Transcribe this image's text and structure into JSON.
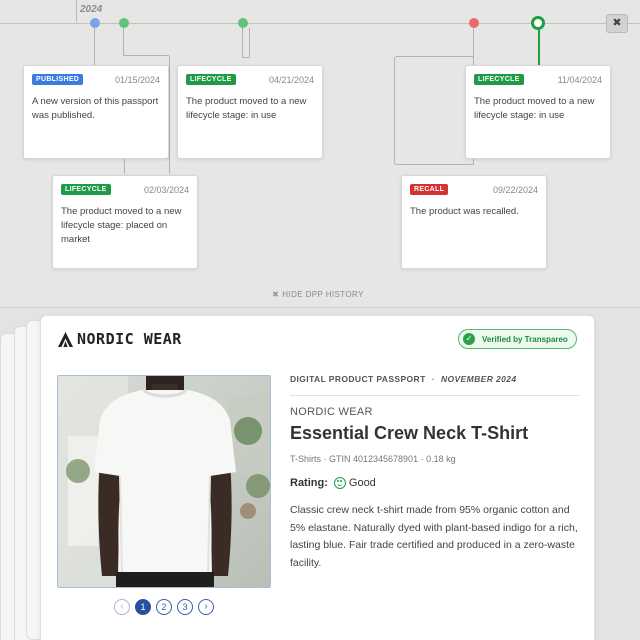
{
  "timeline": {
    "year": "2024",
    "close_label": "✖",
    "hide_label": "HIDE DPP HISTORY",
    "hide_icon": "✖",
    "events": [
      {
        "badge": "PUBLISHED",
        "date": "01/15/2024",
        "text": "A new version of this passport was published."
      },
      {
        "badge": "LIFECYCLE",
        "date": "02/03/2024",
        "text": "The product moved to a new lifecycle stage: placed on market"
      },
      {
        "badge": "LIFECYCLE",
        "date": "04/21/2024",
        "text": "The product moved to a new lifecycle stage: in use"
      },
      {
        "badge": "RECALL",
        "date": "09/22/2024",
        "text": "The product was recalled."
      },
      {
        "badge": "LIFECYCLE",
        "date": "11/04/2024",
        "text": "The product moved to a new lifecycle stage: in use"
      }
    ]
  },
  "passport": {
    "brand_logo": "NORDIC WEAR",
    "verified_label": "Verified by Transpareo",
    "header_label": "DIGITAL PRODUCT PASSPORT",
    "header_sep": "·",
    "header_date": "NOVEMBER 2024",
    "brand": "NORDIC WEAR",
    "title": "Essential Crew Neck T-Shirt",
    "meta": "T-Shirts · GTIN 4012345678901 · 0.18 kg",
    "rating_label": "Rating:",
    "rating_value": "Good",
    "description": "Classic crew neck t-shirt made from 95% organic cotton and 5% elastane. Naturally dyed with plant-based indigo for a rich, lasting blue. Fair trade certified and produced in a zero-waste facility.",
    "pager": {
      "prev": "‹",
      "pages": [
        "1",
        "2",
        "3"
      ],
      "next": "›"
    }
  },
  "colors": {
    "published": "#3a7be0",
    "lifecycle": "#1f9b45",
    "recall": "#d63232",
    "pager_active": "#27509e"
  }
}
